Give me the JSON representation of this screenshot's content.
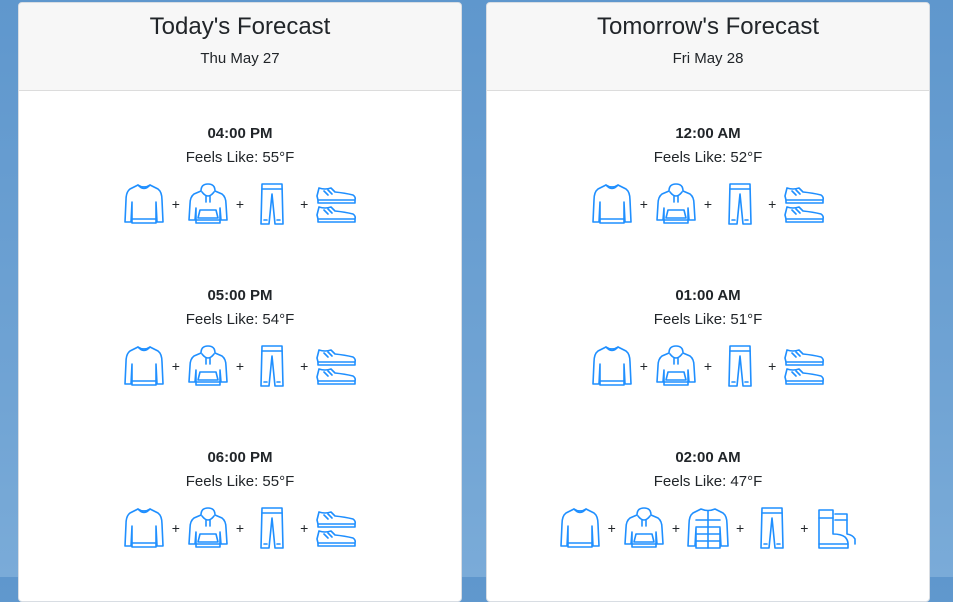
{
  "colors": {
    "icon": "#1f8fff",
    "background": "#6a9fd0"
  },
  "cards": [
    {
      "title": "Today's Forecast",
      "date": "Thu May 27",
      "slots": [
        {
          "time": "04:00 PM",
          "feels": "Feels Like: 55°F",
          "items": [
            "sweater-icon",
            "hoodie-icon",
            "pants-icon",
            "sneakers-icon"
          ]
        },
        {
          "time": "05:00 PM",
          "feels": "Feels Like: 54°F",
          "items": [
            "sweater-icon",
            "hoodie-icon",
            "pants-icon",
            "sneakers-icon"
          ]
        },
        {
          "time": "06:00 PM",
          "feels": "Feels Like: 55°F",
          "items": [
            "sweater-icon",
            "hoodie-icon",
            "pants-icon",
            "sneakers-icon"
          ]
        }
      ]
    },
    {
      "title": "Tomorrow's Forecast",
      "date": "Fri May 28",
      "slots": [
        {
          "time": "12:00 AM",
          "feels": "Feels Like: 52°F",
          "items": [
            "sweater-icon",
            "hoodie-icon",
            "pants-icon",
            "sneakers-icon"
          ]
        },
        {
          "time": "01:00 AM",
          "feels": "Feels Like: 51°F",
          "items": [
            "sweater-icon",
            "hoodie-icon",
            "pants-icon",
            "sneakers-icon"
          ]
        },
        {
          "time": "02:00 AM",
          "feels": "Feels Like: 47°F",
          "items": [
            "sweater-icon",
            "hoodie-icon",
            "puffer-jacket-icon",
            "pants-icon",
            "boots-icon"
          ]
        }
      ]
    }
  ],
  "separator": "+"
}
